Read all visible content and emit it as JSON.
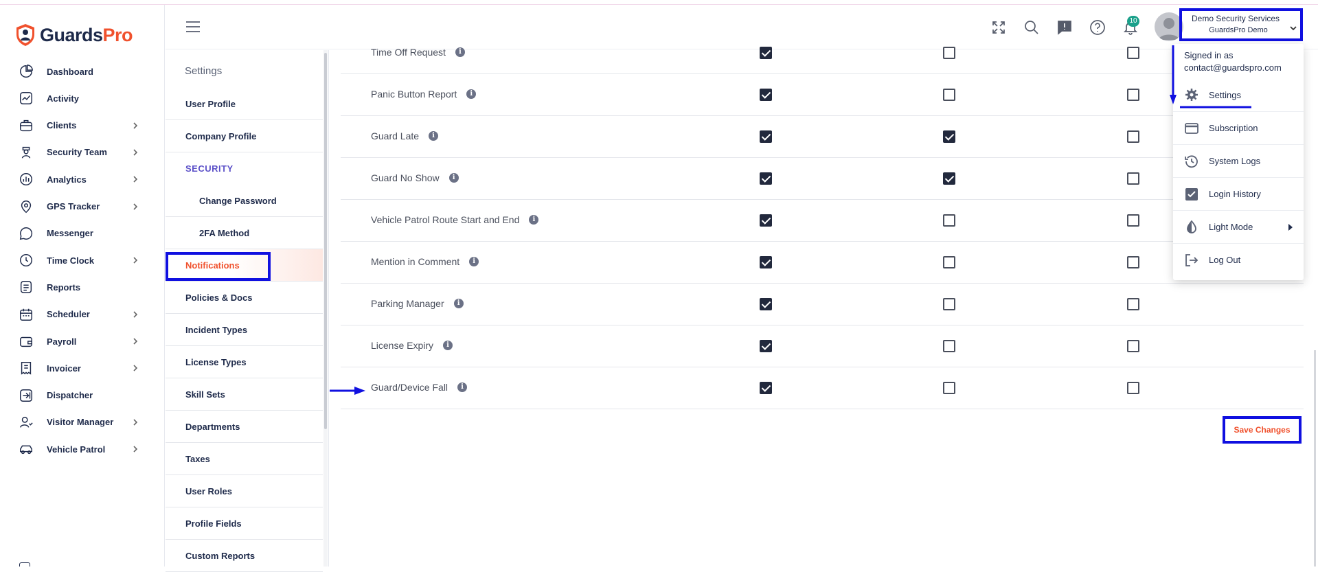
{
  "brand": {
    "name_part1": "Guards",
    "name_part2": "Pro"
  },
  "nav": {
    "items": [
      {
        "label": "Dashboard",
        "icon": "pie-chart-icon",
        "chevron": false
      },
      {
        "label": "Activity",
        "icon": "activity-icon",
        "chevron": false
      },
      {
        "label": "Clients",
        "icon": "briefcase-icon",
        "chevron": true
      },
      {
        "label": "Security Team",
        "icon": "guard-icon",
        "chevron": true
      },
      {
        "label": "Analytics",
        "icon": "bar-chart-icon",
        "chevron": true
      },
      {
        "label": "GPS Tracker",
        "icon": "map-pin-icon",
        "chevron": true
      },
      {
        "label": "Messenger",
        "icon": "chat-icon",
        "chevron": false
      },
      {
        "label": "Time Clock",
        "icon": "clock-icon",
        "chevron": true
      },
      {
        "label": "Reports",
        "icon": "document-icon",
        "chevron": false
      },
      {
        "label": "Scheduler",
        "icon": "calendar-icon",
        "chevron": true
      },
      {
        "label": "Payroll",
        "icon": "wallet-icon",
        "chevron": true
      },
      {
        "label": "Invoicer",
        "icon": "receipt-icon",
        "chevron": true
      },
      {
        "label": "Dispatcher",
        "icon": "dispatch-icon",
        "chevron": false
      },
      {
        "label": "Visitor Manager",
        "icon": "visitor-icon",
        "chevron": true
      },
      {
        "label": "Vehicle Patrol",
        "icon": "car-icon",
        "chevron": true
      }
    ]
  },
  "header": {
    "notification_count": "10",
    "account": {
      "org": "Demo Security Services",
      "sub": "GuardsPro Demo"
    }
  },
  "settings": {
    "title": "Settings",
    "items": [
      {
        "label": "User Profile",
        "kind": "item"
      },
      {
        "label": "Company Profile",
        "kind": "item"
      },
      {
        "label": "SECURITY",
        "kind": "section"
      },
      {
        "label": "Change Password",
        "kind": "sub"
      },
      {
        "label": "2FA Method",
        "kind": "sub"
      },
      {
        "label": "Notifications",
        "kind": "active"
      },
      {
        "label": "Policies & Docs",
        "kind": "item"
      },
      {
        "label": "Incident Types",
        "kind": "item"
      },
      {
        "label": "License Types",
        "kind": "item"
      },
      {
        "label": "Skill Sets",
        "kind": "item"
      },
      {
        "label": "Departments",
        "kind": "item"
      },
      {
        "label": "Taxes",
        "kind": "item"
      },
      {
        "label": "User Roles",
        "kind": "item"
      },
      {
        "label": "Profile Fields",
        "kind": "item"
      },
      {
        "label": "Custom Reports",
        "kind": "item"
      }
    ]
  },
  "notifications": {
    "rows": [
      {
        "name": "Time Off Request",
        "checks": [
          true,
          false,
          false
        ]
      },
      {
        "name": "Panic Button Report",
        "checks": [
          true,
          false,
          false
        ]
      },
      {
        "name": "Guard Late",
        "checks": [
          true,
          true,
          false
        ]
      },
      {
        "name": "Guard No Show",
        "checks": [
          true,
          true,
          false
        ]
      },
      {
        "name": "Vehicle Patrol Route Start and End",
        "checks": [
          true,
          false,
          false
        ]
      },
      {
        "name": "Mention in Comment",
        "checks": [
          true,
          false,
          false
        ]
      },
      {
        "name": "Parking Manager",
        "checks": [
          true,
          false,
          false
        ]
      },
      {
        "name": "License Expiry",
        "checks": [
          true,
          false,
          false
        ]
      },
      {
        "name": "Guard/Device Fall",
        "checks": [
          true,
          false,
          false
        ]
      }
    ],
    "save_label": "Save Changes"
  },
  "user_menu": {
    "signed_in_label": "Signed in as",
    "email": "contact@guardspro.com",
    "items": [
      {
        "label": "Settings",
        "icon": "gear-icon"
      },
      {
        "label": "Subscription",
        "icon": "credit-card-icon"
      },
      {
        "label": "System Logs",
        "icon": "history-icon"
      },
      {
        "label": "Login History",
        "icon": "checkbox-icon"
      },
      {
        "label": "Light Mode",
        "icon": "contrast-icon",
        "submenu": true
      },
      {
        "label": "Log Out",
        "icon": "logout-icon"
      }
    ]
  },
  "colors": {
    "accent": "#f0512d",
    "navy": "#1e2a4a",
    "annotation": "#1010e0",
    "badge": "#1aa08a"
  }
}
